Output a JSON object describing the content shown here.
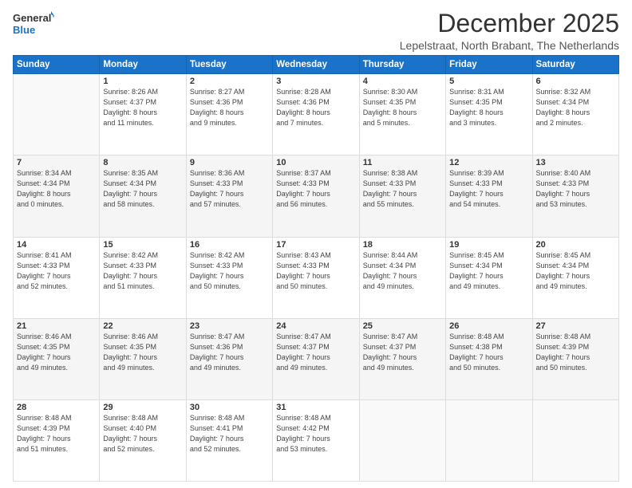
{
  "header": {
    "logo_line1": "General",
    "logo_line2": "Blue",
    "month_title": "December 2025",
    "location": "Lepelstraat, North Brabant, The Netherlands"
  },
  "weekdays": [
    "Sunday",
    "Monday",
    "Tuesday",
    "Wednesday",
    "Thursday",
    "Friday",
    "Saturday"
  ],
  "weeks": [
    [
      {
        "day": "",
        "info": ""
      },
      {
        "day": "1",
        "info": "Sunrise: 8:26 AM\nSunset: 4:37 PM\nDaylight: 8 hours\nand 11 minutes."
      },
      {
        "day": "2",
        "info": "Sunrise: 8:27 AM\nSunset: 4:36 PM\nDaylight: 8 hours\nand 9 minutes."
      },
      {
        "day": "3",
        "info": "Sunrise: 8:28 AM\nSunset: 4:36 PM\nDaylight: 8 hours\nand 7 minutes."
      },
      {
        "day": "4",
        "info": "Sunrise: 8:30 AM\nSunset: 4:35 PM\nDaylight: 8 hours\nand 5 minutes."
      },
      {
        "day": "5",
        "info": "Sunrise: 8:31 AM\nSunset: 4:35 PM\nDaylight: 8 hours\nand 3 minutes."
      },
      {
        "day": "6",
        "info": "Sunrise: 8:32 AM\nSunset: 4:34 PM\nDaylight: 8 hours\nand 2 minutes."
      }
    ],
    [
      {
        "day": "7",
        "info": "Sunrise: 8:34 AM\nSunset: 4:34 PM\nDaylight: 8 hours\nand 0 minutes."
      },
      {
        "day": "8",
        "info": "Sunrise: 8:35 AM\nSunset: 4:34 PM\nDaylight: 7 hours\nand 58 minutes."
      },
      {
        "day": "9",
        "info": "Sunrise: 8:36 AM\nSunset: 4:33 PM\nDaylight: 7 hours\nand 57 minutes."
      },
      {
        "day": "10",
        "info": "Sunrise: 8:37 AM\nSunset: 4:33 PM\nDaylight: 7 hours\nand 56 minutes."
      },
      {
        "day": "11",
        "info": "Sunrise: 8:38 AM\nSunset: 4:33 PM\nDaylight: 7 hours\nand 55 minutes."
      },
      {
        "day": "12",
        "info": "Sunrise: 8:39 AM\nSunset: 4:33 PM\nDaylight: 7 hours\nand 54 minutes."
      },
      {
        "day": "13",
        "info": "Sunrise: 8:40 AM\nSunset: 4:33 PM\nDaylight: 7 hours\nand 53 minutes."
      }
    ],
    [
      {
        "day": "14",
        "info": "Sunrise: 8:41 AM\nSunset: 4:33 PM\nDaylight: 7 hours\nand 52 minutes."
      },
      {
        "day": "15",
        "info": "Sunrise: 8:42 AM\nSunset: 4:33 PM\nDaylight: 7 hours\nand 51 minutes."
      },
      {
        "day": "16",
        "info": "Sunrise: 8:42 AM\nSunset: 4:33 PM\nDaylight: 7 hours\nand 50 minutes."
      },
      {
        "day": "17",
        "info": "Sunrise: 8:43 AM\nSunset: 4:33 PM\nDaylight: 7 hours\nand 50 minutes."
      },
      {
        "day": "18",
        "info": "Sunrise: 8:44 AM\nSunset: 4:34 PM\nDaylight: 7 hours\nand 49 minutes."
      },
      {
        "day": "19",
        "info": "Sunrise: 8:45 AM\nSunset: 4:34 PM\nDaylight: 7 hours\nand 49 minutes."
      },
      {
        "day": "20",
        "info": "Sunrise: 8:45 AM\nSunset: 4:34 PM\nDaylight: 7 hours\nand 49 minutes."
      }
    ],
    [
      {
        "day": "21",
        "info": "Sunrise: 8:46 AM\nSunset: 4:35 PM\nDaylight: 7 hours\nand 49 minutes."
      },
      {
        "day": "22",
        "info": "Sunrise: 8:46 AM\nSunset: 4:35 PM\nDaylight: 7 hours\nand 49 minutes."
      },
      {
        "day": "23",
        "info": "Sunrise: 8:47 AM\nSunset: 4:36 PM\nDaylight: 7 hours\nand 49 minutes."
      },
      {
        "day": "24",
        "info": "Sunrise: 8:47 AM\nSunset: 4:37 PM\nDaylight: 7 hours\nand 49 minutes."
      },
      {
        "day": "25",
        "info": "Sunrise: 8:47 AM\nSunset: 4:37 PM\nDaylight: 7 hours\nand 49 minutes."
      },
      {
        "day": "26",
        "info": "Sunrise: 8:48 AM\nSunset: 4:38 PM\nDaylight: 7 hours\nand 50 minutes."
      },
      {
        "day": "27",
        "info": "Sunrise: 8:48 AM\nSunset: 4:39 PM\nDaylight: 7 hours\nand 50 minutes."
      }
    ],
    [
      {
        "day": "28",
        "info": "Sunrise: 8:48 AM\nSunset: 4:39 PM\nDaylight: 7 hours\nand 51 minutes."
      },
      {
        "day": "29",
        "info": "Sunrise: 8:48 AM\nSunset: 4:40 PM\nDaylight: 7 hours\nand 52 minutes."
      },
      {
        "day": "30",
        "info": "Sunrise: 8:48 AM\nSunset: 4:41 PM\nDaylight: 7 hours\nand 52 minutes."
      },
      {
        "day": "31",
        "info": "Sunrise: 8:48 AM\nSunset: 4:42 PM\nDaylight: 7 hours\nand 53 minutes."
      },
      {
        "day": "",
        "info": ""
      },
      {
        "day": "",
        "info": ""
      },
      {
        "day": "",
        "info": ""
      }
    ]
  ]
}
